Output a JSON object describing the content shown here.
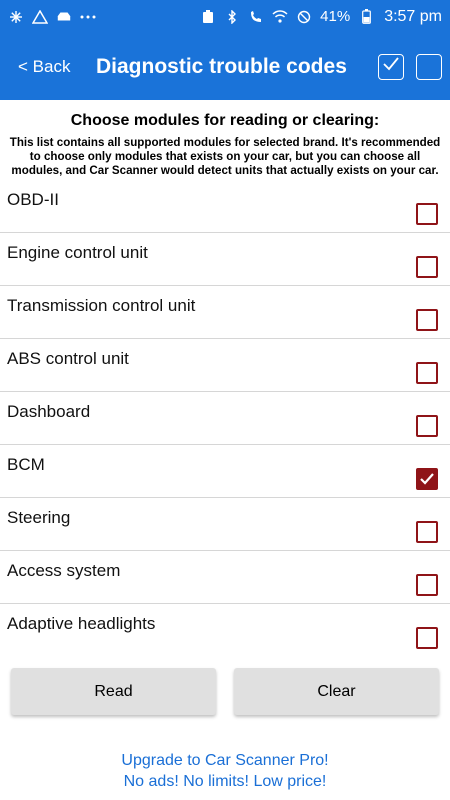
{
  "status_bar": {
    "battery_percent": "41%",
    "time": "3:57 pm",
    "left_icons": [
      "sparkle-icon",
      "warning-icon",
      "car-icon",
      "more-icon"
    ],
    "right_icons": [
      "battery-saver-icon",
      "bluetooth-icon",
      "wifi-call-icon",
      "wifi-icon",
      "do-not-disturb-icon",
      "battery-icon"
    ]
  },
  "header": {
    "back_label": "< Back",
    "title": "Diagnostic trouble codes"
  },
  "main": {
    "heading": "Choose modules for reading or clearing:",
    "description": "This list contains all supported modules for selected brand. It's recommended to choose only modules that exists on your car, but you can choose all modules, and Car Scanner would detect units that actually exists on your car."
  },
  "modules": [
    {
      "label": "OBD-II",
      "checked": false
    },
    {
      "label": "Engine control unit",
      "checked": false
    },
    {
      "label": "Transmission control unit",
      "checked": false
    },
    {
      "label": "ABS control unit",
      "checked": false
    },
    {
      "label": "Dashboard",
      "checked": false
    },
    {
      "label": "BCM",
      "checked": true
    },
    {
      "label": "Steering",
      "checked": false
    },
    {
      "label": "Access system",
      "checked": false
    },
    {
      "label": "Adaptive headlights",
      "checked": false
    }
  ],
  "buttons": {
    "read_label": "Read",
    "clear_label": "Clear"
  },
  "promo": {
    "line1": "Upgrade to Car Scanner Pro!",
    "line2": "No ads! No limits! Low price!"
  },
  "colors": {
    "primary": "#1a73d9",
    "checkbox": "#8f1418",
    "link": "#1a6fd6"
  }
}
